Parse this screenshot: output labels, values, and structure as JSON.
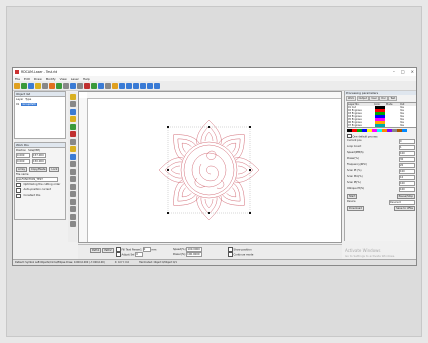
{
  "window": {
    "title": "RDCAM-Laser - Test.rld"
  },
  "window_controls": {
    "minimize": "–",
    "maximize": "□",
    "close": "×"
  },
  "menu": [
    "File",
    "Edit",
    "Draw",
    "Modify",
    "View",
    "Laser",
    "Help"
  ],
  "toolbar_colors": [
    "#e0a020",
    "#3a9a3a",
    "#3a7bd5",
    "#d9b020",
    "#888888",
    "#e07020",
    "#3a9a3a",
    "#888888",
    "#3a7bd5",
    "#888888",
    "#c03030",
    "#3a9a3a",
    "#3a7bd5",
    "#888888",
    "#e0a020",
    "#3a7bd5",
    "#3a7bd5",
    "#3a7bd5",
    "#3a7bd5",
    "#3a7bd5",
    "#3a7bd5"
  ],
  "layers_panel": {
    "title": "Object list",
    "headers": [
      "Layer",
      "Type"
    ],
    "rows": [
      {
        "layer": "01",
        "type": "GroupPath"
      }
    ]
  },
  "position_panel": {
    "title": "Work Pos",
    "position_label": "Position",
    "size_label": "Size(MM)",
    "x": "0.000",
    "y": "0.000",
    "w": "157.000",
    "h": "150.000",
    "buttons": [
      "Array",
      "Copy/Paste",
      "Lock"
    ],
    "file_label": "File name",
    "file_value": "ALLFUNCTION_TEST",
    "options": [
      "Optimizing the cutting order",
      "Auto-position current",
      "Constant Pos"
    ]
  },
  "right_panel": {
    "title": "Processing parameters",
    "tabs": [
      "Work",
      "Output",
      "User",
      "Doc",
      "Test"
    ],
    "table_headers": [
      "Layer No.",
      "Color",
      "Mode",
      "Out"
    ],
    "layers": [
      {
        "name": "01 Cut",
        "color": "#000000",
        "out": "Yes"
      },
      {
        "name": "02 Engrave",
        "color": "#ff0000",
        "out": "Yes"
      },
      {
        "name": "03 Engrave",
        "color": "#00aa00",
        "out": "Yes"
      },
      {
        "name": "04 Engrave",
        "color": "#0000ff",
        "out": "Yes"
      },
      {
        "name": "05 Engrave",
        "color": "#ff00ff",
        "out": "Yes"
      },
      {
        "name": "06 Engrave",
        "color": "#ffaa00",
        "out": "Yes"
      },
      {
        "name": "07 Engrave",
        "color": "#00aaaa",
        "out": "Yes"
      }
    ],
    "palette": [
      "#000000",
      "#ff0000",
      "#00aa00",
      "#0000ff",
      "#ffff00",
      "#ff00ff",
      "#00ffff",
      "#ff8800",
      "#8800ff",
      "#888888",
      "#aa5500",
      "#0088ff"
    ],
    "one_pass_label": "One default process",
    "fields": [
      {
        "label": "Current pos",
        "value": "0"
      },
      {
        "label": "Loop Count",
        "value": "1"
      },
      {
        "label": "Speed(MM/S)",
        "value": "100"
      },
      {
        "label": "Power(%)",
        "value": "30"
      },
      {
        "label": "Frequency(KHz)",
        "value": "20"
      },
      {
        "label": "Scan Pt (%)",
        "value": "100"
      },
      {
        "label": "Scan Min(%)",
        "value": "10"
      },
      {
        "label": "Scan Pt(%)",
        "value": "100"
      },
      {
        "label": "Oblique Pt(%)",
        "value": "100"
      }
    ],
    "buttons": [
      "Start",
      "Pause/Stop",
      "Download",
      "Save to UFile"
    ],
    "checkboxes": [
      "Go scale"
    ],
    "port_label": "Device",
    "port_value": "Device:0",
    "go_button": "Go"
  },
  "bottom_bar": {
    "labels": [
      "Path1",
      "Path2"
    ],
    "fill_label": "Fill Text",
    "param1_label": "Param1",
    "param1_value": "0",
    "sel_label": "Sel",
    "sel_value": "0",
    "adj_label": "Adjust",
    "adj_value": "0",
    "unit": "mm",
    "left_label": "Speed(%)",
    "left_value": "100.0000",
    "right_label": "Power(%)",
    "right_value": "100.0000",
    "opt1": "Show position",
    "opt2": "Continue mode"
  },
  "statusbar": {
    "left": "Default: Symbol Left:Objects/Circle/Ellipse Draw, 0.000,0.000 (-7.000,0.00)",
    "center": "X: 0.0 Y: 0.0",
    "right": "Hardcoded: Object 0/Object 0/1"
  },
  "watermark": {
    "line1": "Activate Windows",
    "line2": "Go to Settings to activate Windows."
  }
}
